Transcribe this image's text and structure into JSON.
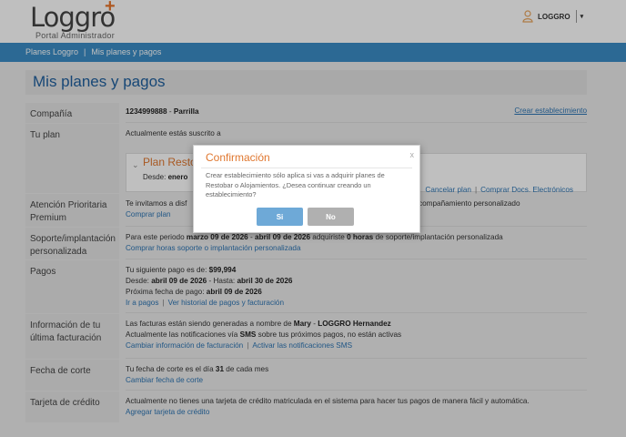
{
  "header": {
    "logo_text": "Loggro",
    "logo_plus": "+",
    "logo_subtitle": "Portal Administrador",
    "user_name": "LOGGRO",
    "user_caret": "▾"
  },
  "breadcrumb": {
    "items": [
      "Planes Loggro",
      "Mis planes y pagos"
    ],
    "separator": "|"
  },
  "page_title": "Mis planes y pagos",
  "rows": {
    "compania": {
      "label": "Compañía",
      "id": "1234999888",
      "dash": " - ",
      "name": "Parrilla",
      "link": "Crear establecimiento"
    },
    "plan": {
      "label": "Tu plan",
      "intro": "Actualmente estás suscrito a",
      "plan_name": "Plan Restob",
      "desde_label": "Desde: ",
      "desde_value": "enero",
      "link_cancel": "Cancelar plan",
      "link_docs": "Comprar Docs. Electrónicos"
    },
    "atencion": {
      "label": "Atención Prioritaria Premium",
      "text_a": "Te invitamos a disf",
      "text_b": "compañamiento personalizado",
      "link": "Comprar plan"
    },
    "soporte": {
      "label": "Soporte/implantación personalizada",
      "t1": "Para este periodo ",
      "t2": "marzo 09 de 2026",
      "t3": " - ",
      "t4": "abril 09 de 2026",
      "t5": " adquiriste ",
      "t6": "0 horas",
      "t7": " de soporte/implantación personalizada",
      "link": "Comprar horas soporte o implantación personalizada"
    },
    "pagos": {
      "label": "Pagos",
      "next_label": "Tu siguiente pago es de: ",
      "next_value": "$99,994",
      "desde_label": "Desde: ",
      "desde_value": "abril 09 de 2026",
      "hasta_label": " - Hasta: ",
      "hasta_value": "abril 30 de 2026",
      "fecha_label": "Próxima fecha de pago: ",
      "fecha_value": "abril 09 de 2026",
      "link_pay": "Ir a pagos",
      "link_history": "Ver historial de pagos y facturación"
    },
    "facturacion": {
      "label": "Información de tu última facturación",
      "t1": "Las facturas están siendo generadas a nombre de ",
      "t2": "Mary",
      "t3": " - ",
      "t4": "LOGGRO Hernandez",
      "n1": "Actualmente las notificaciones vía ",
      "n2": "SMS",
      "n3": " sobre tus próximos pagos, no están activas",
      "link_change": "Cambiar información de facturación",
      "link_sms": "Activar las notificaciones SMS"
    },
    "corte": {
      "label": "Fecha de corte",
      "t1": "Tu fecha de corte es el día ",
      "t2": "31",
      "t3": " de cada mes",
      "link": "Cambiar fecha de corte"
    },
    "tarjeta": {
      "label": "Tarjeta de crédito",
      "text": "Actualmente no tienes una tarjeta de crédito matriculada en el sistema para hacer tus pagos de manera fácil y automática.",
      "link": "Agregar tarjeta de crédito"
    }
  },
  "modal": {
    "title": "Confirmación",
    "close": "x",
    "message": "Crear establecimiento sólo aplica si vas a adquirir planes de Restobar o Alojamientos. ¿Desea continuar creando un establecimiento?",
    "yes_label": "Si",
    "no_label": "No"
  },
  "colors": {
    "brand_blue": "#3b8dc6",
    "accent_orange": "#e0772f",
    "link_blue": "#2c74b3"
  },
  "icons": [
    "user-icon",
    "caret-down-icon",
    "chevron-down-icon",
    "close-icon"
  ]
}
